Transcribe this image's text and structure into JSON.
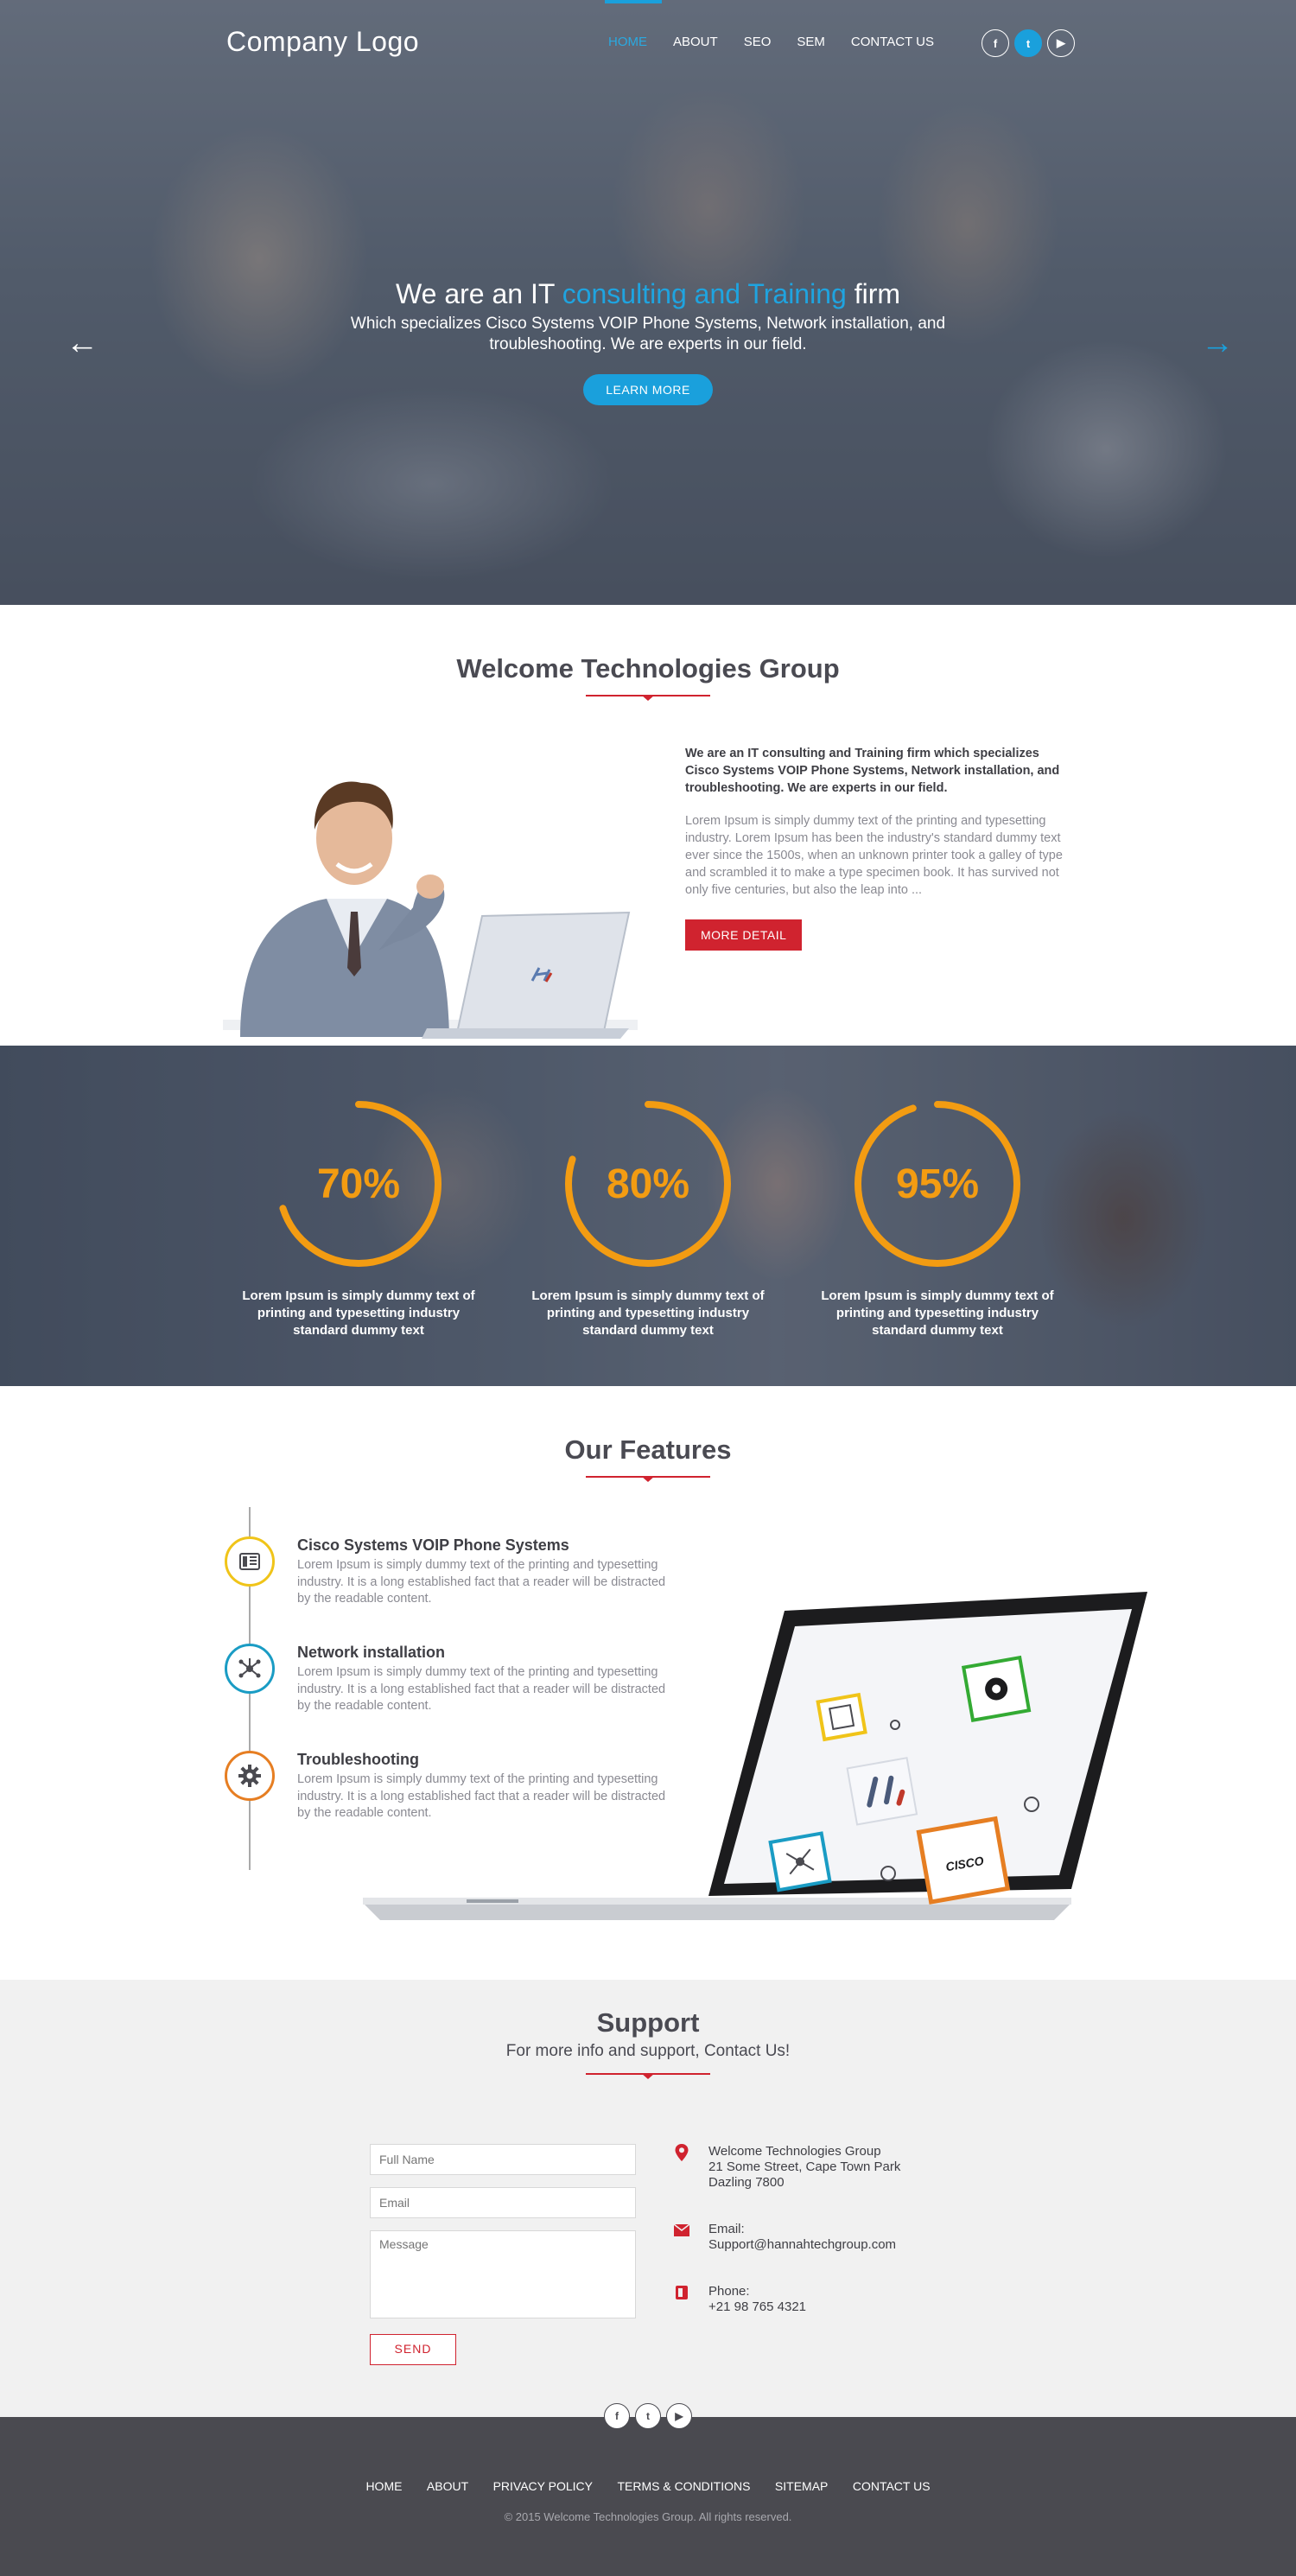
{
  "header": {
    "logo": "Company Logo",
    "nav": [
      "HOME",
      "ABOUT",
      "SEO",
      "SEM",
      "CONTACT US"
    ],
    "social": [
      "f",
      "t",
      "▶"
    ]
  },
  "hero": {
    "title_pre": "We are an IT ",
    "title_highlight": "consulting and Training",
    "title_post": " firm",
    "subtitle": "Which specializes Cisco Systems VOIP Phone Systems, Network installation, and troubleshooting. We are experts in our field.",
    "button": "LEARN MORE",
    "prev_arrow": "←",
    "next_arrow": "→",
    "accent_color": "#1aa0dc"
  },
  "welcome": {
    "title": "Welcome Technologies Group",
    "intro": "We are an IT consulting and Training firm which specializes Cisco Systems VOIP Phone Systems, Network installation, and troubleshooting. We are experts in our field.",
    "body": "Lorem Ipsum is simply dummy text of the printing and typesetting industry. Lorem Ipsum has been the industry's standard dummy text ever since the 1500s, when an unknown printer took a galley of type and scrambled it to make a type specimen book.  It has survived not only five centuries, but also the leap into ...",
    "button": "MORE DETAIL",
    "button_color": "#d0232f"
  },
  "stats": [
    {
      "value": "70%",
      "fraction": 0.7,
      "label": "Lorem Ipsum is simply dummy text of printing and typesetting industry standard dummy text"
    },
    {
      "value": "80%",
      "fraction": 0.8,
      "label": "Lorem Ipsum is simply dummy text of printing and typesetting industry standard dummy text"
    },
    {
      "value": "95%",
      "fraction": 0.95,
      "label": "Lorem Ipsum is simply dummy text of printing and typesetting industry standard dummy text"
    }
  ],
  "stats_color": "#f39c12",
  "features": {
    "title": "Our Features",
    "items": [
      {
        "title": "Cisco Systems VOIP Phone Systems",
        "text": "Lorem Ipsum is simply dummy text of the printing and typesetting industry. It is a long established fact that a reader will be distracted by the readable content.",
        "icon": "phone-icon",
        "color": "#f0c419"
      },
      {
        "title": "Network installation",
        "text": "Lorem Ipsum is simply dummy text of the printing and typesetting industry. It is a long established fact that a reader will be distracted by the readable content.",
        "icon": "network-icon",
        "color": "#1a9cc4"
      },
      {
        "title": "Troubleshooting",
        "text": "Lorem Ipsum is simply dummy text of the printing and typesetting industry. It is a long established fact that a reader will be distracted by the readable content.",
        "icon": "gear-icon",
        "color": "#e67e22"
      }
    ],
    "laptop_cisco_label": "CISCO"
  },
  "support": {
    "title": "Support",
    "subtitle": "For more info and support, Contact Us!",
    "fullname_placeholder": "Full Name",
    "email_placeholder": "Email",
    "message_placeholder": "Message",
    "send": "SEND",
    "address": "Welcome Technologies Group\n21 Some Street, Cape Town Park\nDazling 7800",
    "email": "Email:\nSupport@hannahtechgroup.com",
    "phone": "Phone:\n+21 98 765 4321"
  },
  "footer": {
    "nav": [
      "HOME",
      "ABOUT",
      "PRIVACY POLICY",
      "TERMS & CONDITIONS",
      "SITEMAP",
      "CONTACT US"
    ],
    "copyright": "© 2015 Welcome Technologies Group. All rights reserved."
  }
}
